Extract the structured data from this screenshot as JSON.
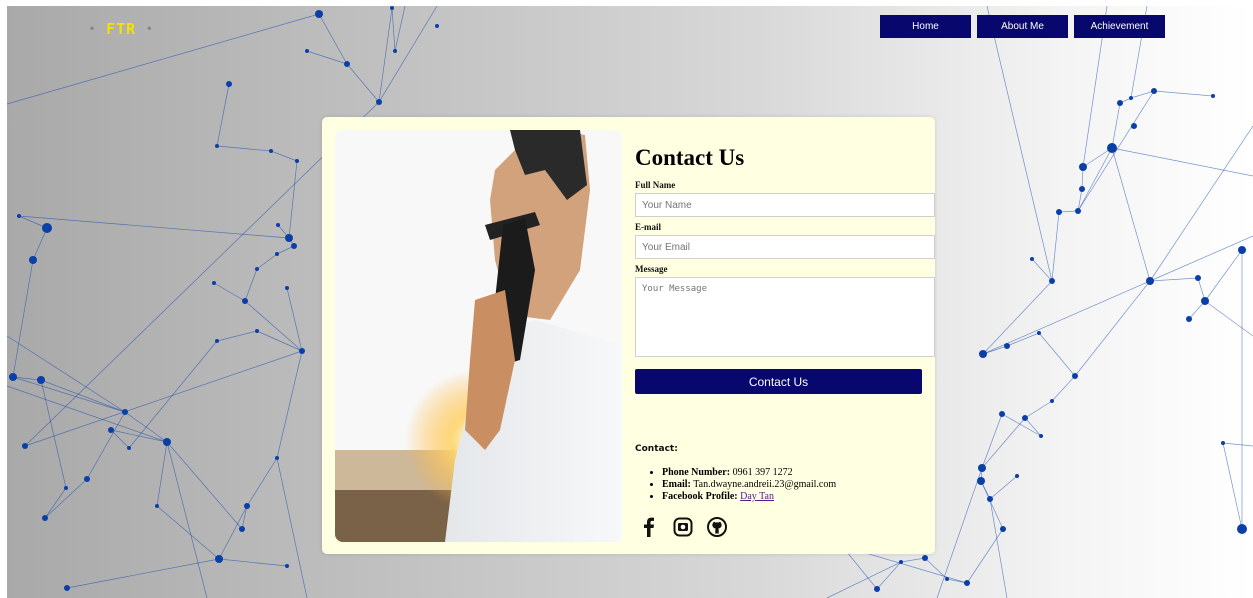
{
  "logo": {
    "text": "FTR"
  },
  "nav": {
    "items": [
      "Home",
      "About Me",
      "Achievement"
    ]
  },
  "form": {
    "title": "Contact Us",
    "name_label": "Full Name",
    "name_placeholder": "Your Name",
    "email_label": "E-mail",
    "email_placeholder": "Your Email",
    "message_label": "Message",
    "message_placeholder": "Your Message",
    "submit_label": "Contact Us"
  },
  "contact": {
    "heading": "Contact:",
    "phone_label": "Phone Number:",
    "phone_value": "0961 397 1272",
    "email_label": "Email:",
    "email_value": "Tan.dwayne.andreii.23@gmail.com",
    "facebook_label": "Facebook Profile:",
    "facebook_value": "Day Tan"
  },
  "socials": [
    "facebook-icon",
    "instagram-icon",
    "github-icon"
  ],
  "colors": {
    "nav_bg": "#07076e",
    "card_bg": "#ffffe1",
    "network": "#0a3fa8",
    "logo": "#f5e100"
  }
}
